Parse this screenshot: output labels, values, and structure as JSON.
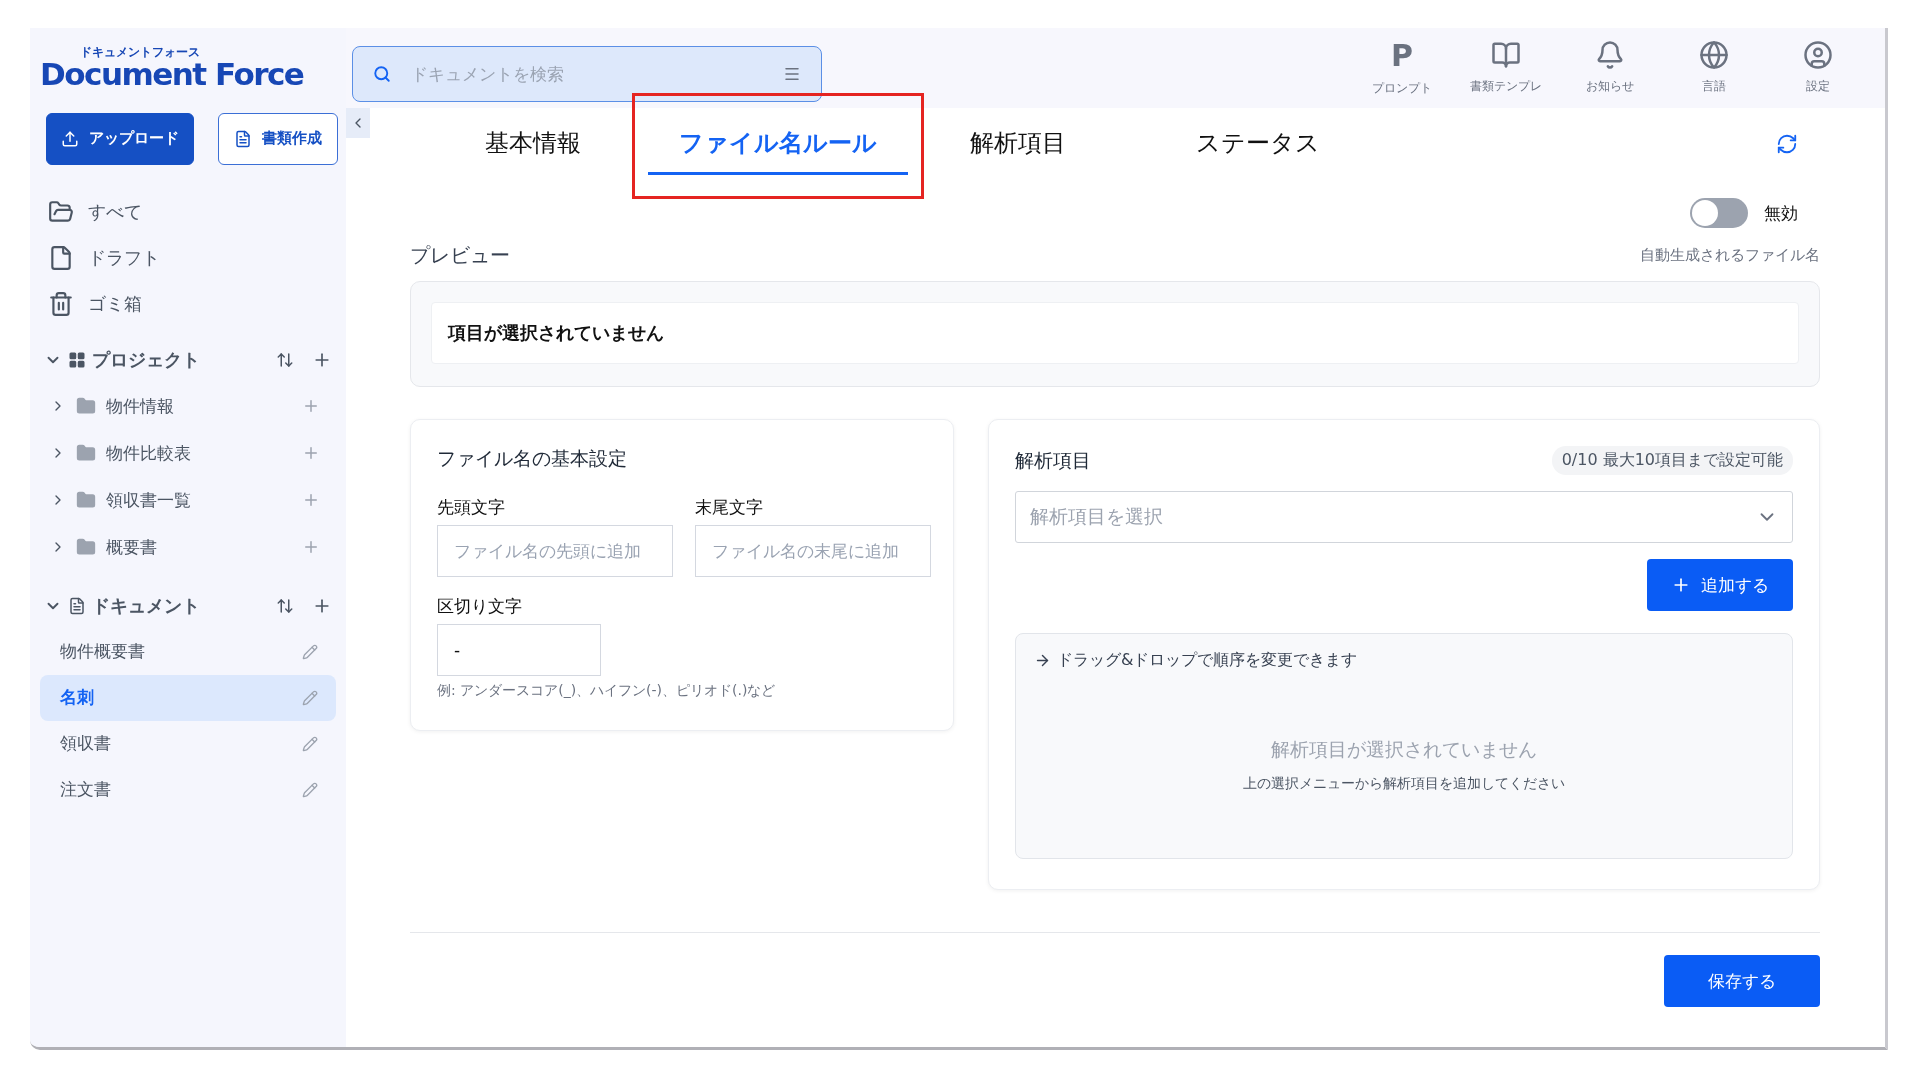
{
  "logo": {
    "kana": "ドキュメントフォース",
    "name": "Document Force"
  },
  "search": {
    "placeholder": "ドキュメントを検索"
  },
  "header_actions": [
    {
      "kind": "prompt",
      "glyph": "P",
      "label": "プロンプト"
    },
    {
      "kind": "template",
      "label": "書類テンプレ"
    },
    {
      "kind": "bell",
      "label": "お知らせ"
    },
    {
      "kind": "globe",
      "label": "言語"
    },
    {
      "kind": "user",
      "label": "設定"
    }
  ],
  "sidebar": {
    "buttons": [
      {
        "kind": "primary",
        "label": "アップロード"
      },
      {
        "kind": "outline",
        "label": "書類作成"
      }
    ],
    "nav": [
      {
        "kind": "folder",
        "label": "すべて"
      },
      {
        "kind": "file",
        "label": "ドラフト"
      },
      {
        "kind": "trash",
        "label": "ゴミ箱"
      }
    ],
    "projects": {
      "title": "プロジェクト",
      "expanded": true,
      "items": [
        {
          "label": "物件情報",
          "expanded": false
        },
        {
          "label": "物件比較表",
          "expanded": false
        },
        {
          "label": "領収書一覧",
          "expanded": false
        },
        {
          "label": "概要書",
          "expanded": false
        }
      ]
    },
    "documents": {
      "title": "ドキュメント",
      "expanded": true,
      "items": [
        {
          "label": "物件概要書",
          "selected": false
        },
        {
          "label": "名刺",
          "selected": true
        },
        {
          "label": "領収書",
          "selected": false
        },
        {
          "label": "注文書",
          "selected": false
        }
      ]
    }
  },
  "tabs": [
    {
      "label": "基本情報",
      "selected": false,
      "highlighted": false
    },
    {
      "label": "ファイル名ルール",
      "selected": true,
      "highlighted": true
    },
    {
      "label": "解析項目",
      "selected": false,
      "highlighted": false
    },
    {
      "label": "ステータス",
      "selected": false,
      "highlighted": false
    }
  ],
  "toggle": {
    "on": false,
    "label": "無効"
  },
  "preview": {
    "title": "プレビュー",
    "hint": "自動生成されるファイル名",
    "value": "項目が選択されていません"
  },
  "basic_settings": {
    "title": "ファイル名の基本設定",
    "prefix": {
      "label": "先頭文字",
      "placeholder": "ファイル名の先頭に追加"
    },
    "suffix": {
      "label": "末尾文字",
      "placeholder": "ファイル名の末尾に追加"
    },
    "separator": {
      "label": "区切り文字",
      "value": "-"
    },
    "example": "例: アンダースコア(_)、ハイフン(-)、ピリオド(.)など"
  },
  "analysis": {
    "title": "解析項目",
    "count": "0/10 最大10項目まで設定可能",
    "select": {
      "placeholder": "解析項目を選択"
    },
    "add_button": "追加する",
    "drag_hint": "ドラッグ&ドロップで順序を変更できます",
    "empty_title": "解析項目が選択されていません",
    "empty_subtitle": "上の選択メニューから解析項目を追加してください"
  },
  "save_button": "保存する"
}
